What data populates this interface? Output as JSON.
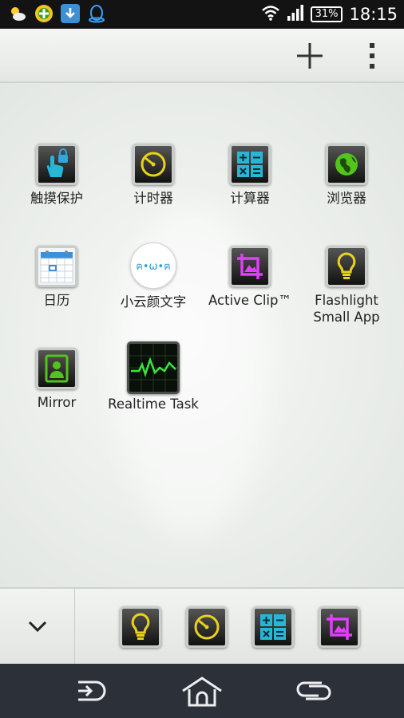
{
  "status_bar": {
    "icons": [
      "weather-icon",
      "app-store-icon",
      "download-icon",
      "qq-icon",
      "wifi-icon",
      "signal-icon"
    ],
    "battery": "31%",
    "time": "18:15"
  },
  "action_bar": {
    "add_icon": "plus-icon",
    "menu_icon": "overflow-menu-icon"
  },
  "apps": [
    {
      "label": "触摸保护",
      "icon": "touch-lock-icon"
    },
    {
      "label": "计时器",
      "icon": "timer-icon"
    },
    {
      "label": "计算器",
      "icon": "calculator-icon"
    },
    {
      "label": "浏览器",
      "icon": "browser-globe-icon"
    },
    {
      "label": "日历",
      "icon": "calendar-icon"
    },
    {
      "label": "小云颜文字",
      "icon": "kaomoji-icon",
      "icon_text": "ฅ•ω•ฅ"
    },
    {
      "label": "Active Clip™",
      "icon": "crop-icon"
    },
    {
      "label": "Flashlight Small App",
      "icon": "lightbulb-icon"
    },
    {
      "label": "Mirror",
      "icon": "mirror-portrait-icon"
    },
    {
      "label": "Realtime Task",
      "icon": "task-monitor-icon"
    }
  ],
  "dock": {
    "toggle_icon": "chevron-down-icon",
    "apps": [
      "lightbulb-icon",
      "timer-icon",
      "calculator-icon",
      "crop-icon"
    ]
  },
  "nav_bar": {
    "buttons": [
      "back-icon",
      "home-icon",
      "recent-apps-icon"
    ]
  },
  "colors": {
    "accent_yellow": "#e8d21a",
    "accent_blue": "#27b6d6",
    "accent_green": "#52c41a",
    "accent_magenta": "#e040fb"
  }
}
